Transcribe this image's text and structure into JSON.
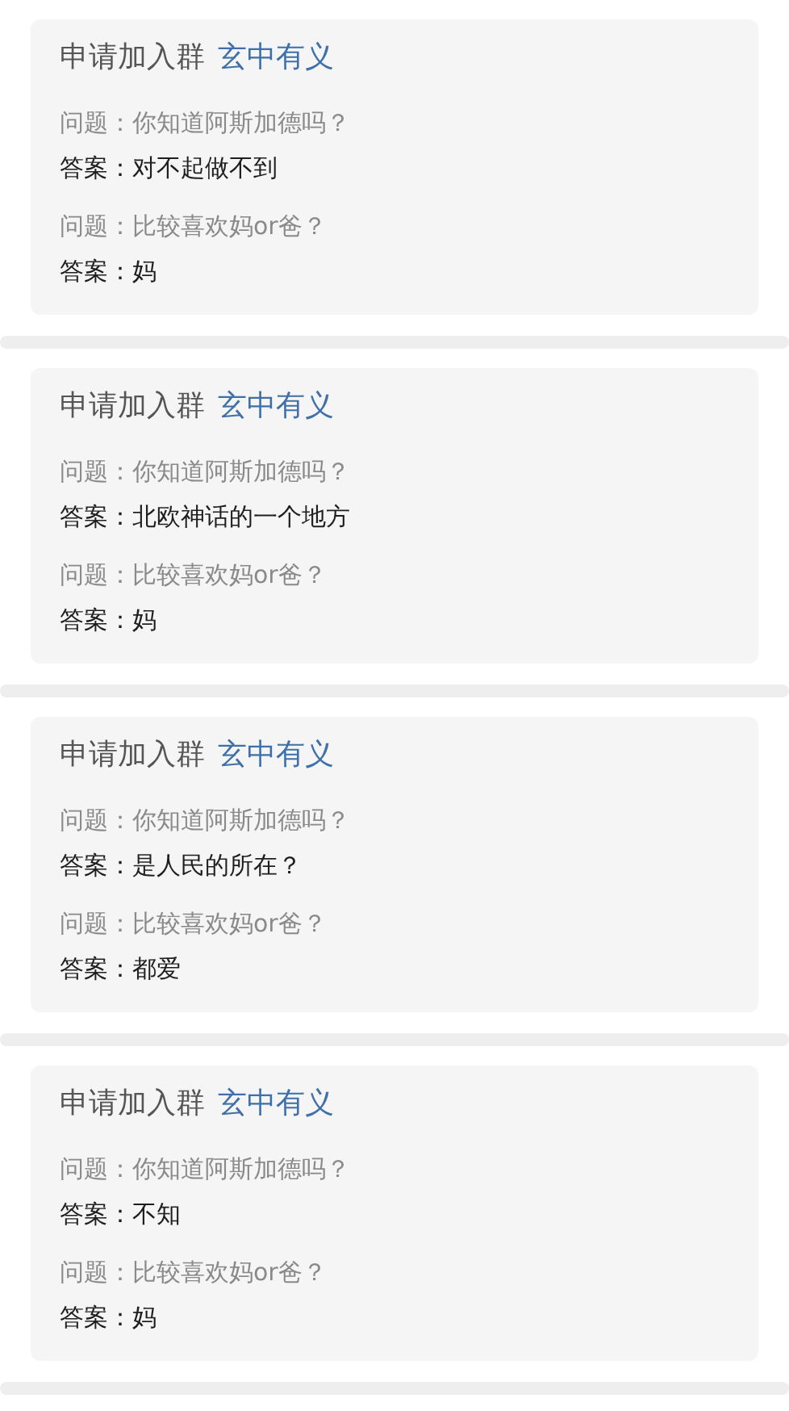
{
  "requests": [
    {
      "prefix": "申请加入群",
      "group": "玄中有义",
      "qa": [
        {
          "question": "问题：你知道阿斯加德吗？",
          "answer": "答案：对不起做不到"
        },
        {
          "question": "问题：比较喜欢妈or爸？",
          "answer": "答案：妈"
        }
      ]
    },
    {
      "prefix": "申请加入群",
      "group": "玄中有义",
      "qa": [
        {
          "question": "问题：你知道阿斯加德吗？",
          "answer": "答案：北欧神话的一个地方"
        },
        {
          "question": "问题：比较喜欢妈or爸？",
          "answer": "答案：妈"
        }
      ]
    },
    {
      "prefix": "申请加入群",
      "group": "玄中有义",
      "qa": [
        {
          "question": "问题：你知道阿斯加德吗？",
          "answer": "答案：是人民的所在？"
        },
        {
          "question": "问题：比较喜欢妈or爸？",
          "answer": "答案：都爱"
        }
      ]
    },
    {
      "prefix": "申请加入群",
      "group": "玄中有义",
      "qa": [
        {
          "question": "问题：你知道阿斯加德吗？",
          "answer": "答案：不知"
        },
        {
          "question": "问题：比较喜欢妈or爸？",
          "answer": "答案：妈"
        }
      ]
    }
  ]
}
